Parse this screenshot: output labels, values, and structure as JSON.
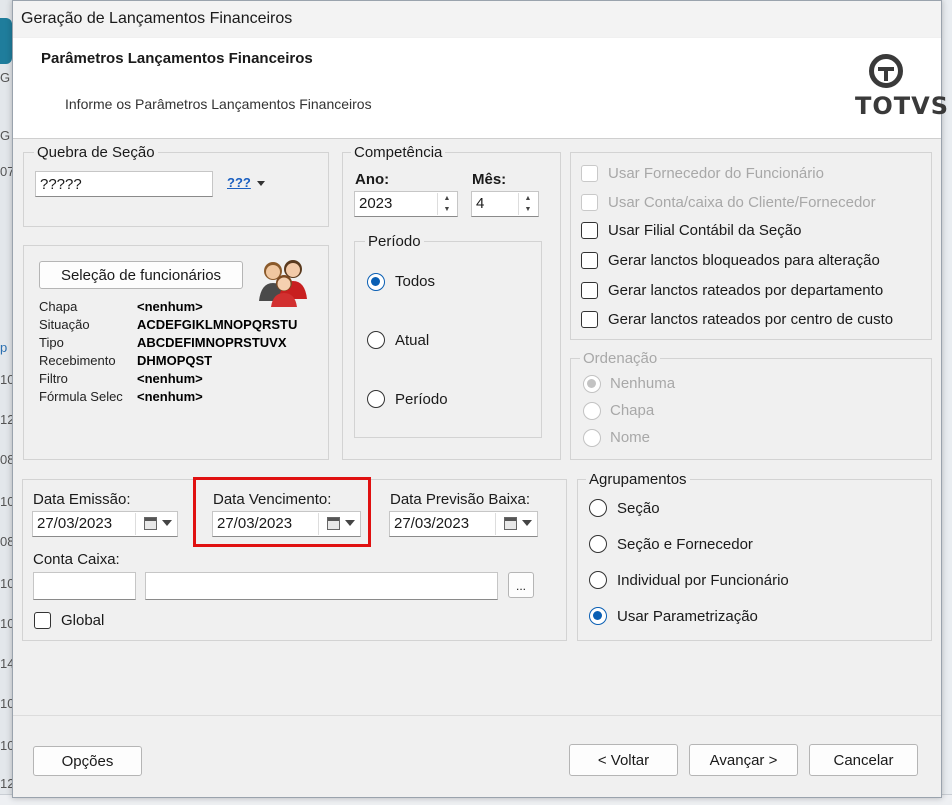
{
  "window": {
    "title": "Geração de Lançamentos Financeiros"
  },
  "background": {
    "left_fragments": [
      "G",
      "G",
      "07",
      "p",
      "10",
      "12",
      "08",
      "10",
      "08",
      "10",
      "10",
      "14",
      "10",
      "10",
      "12"
    ]
  },
  "header": {
    "title": "Parâmetros Lançamentos Financeiros",
    "subtitle": "Informe os Parâmetros Lançamentos Financeiros",
    "logo_text": "TOTVS"
  },
  "quebra": {
    "label": "Quebra de Seção",
    "value": "?????",
    "lookup_label": "???"
  },
  "selecao": {
    "button_label": "Seleção de funcionários",
    "fields": [
      {
        "label": "Chapa",
        "value": "<nenhum>"
      },
      {
        "label": "Situação",
        "value": "ACDEFGIKLMNOPQRSTU"
      },
      {
        "label": "Tipo",
        "value": "ABCDEFIMNOPRSTUVX"
      },
      {
        "label": "Recebimento",
        "value": "DHMOPQST"
      },
      {
        "label": "Filtro",
        "value": "<nenhum>"
      },
      {
        "label": "Fórmula Selec",
        "value": "<nenhum>"
      }
    ]
  },
  "competencia": {
    "label": "Competência",
    "ano_label": "Ano:",
    "ano_value": "2023",
    "mes_label": "Mês:",
    "mes_value": "4",
    "periodo_label": "Período",
    "options": [
      "Todos",
      "Atual",
      "Período"
    ],
    "selected": "Todos"
  },
  "options_checks": [
    {
      "label": "Usar Fornecedor do Funcionário",
      "checked": false,
      "enabled": false
    },
    {
      "label": "Usar Conta/caixa do Cliente/Fornecedor",
      "checked": false,
      "enabled": false
    },
    {
      "label": "Usar Filial Contábil da Seção",
      "checked": false,
      "enabled": true
    },
    {
      "label": "Gerar lanctos bloqueados para alteração",
      "checked": false,
      "enabled": true
    },
    {
      "label": "Gerar lanctos rateados por departamento",
      "checked": false,
      "enabled": true
    },
    {
      "label": "Gerar lanctos rateados por centro de custo",
      "checked": false,
      "enabled": true
    }
  ],
  "ordenacao": {
    "label": "Ordenação",
    "options": [
      "Nenhuma",
      "Chapa",
      "Nome"
    ],
    "selected": "Nenhuma",
    "enabled": false
  },
  "datas": {
    "emissao_label": "Data Emissão:",
    "emissao_value": "27/03/2023",
    "vencimento_label": "Data Vencimento:",
    "vencimento_value": "27/03/2023",
    "previsao_label": "Data Previsão Baixa:",
    "previsao_value": "27/03/2023",
    "conta_label": "Conta Caixa:",
    "conta_code": "",
    "conta_desc": "",
    "lookup_button": "...",
    "global_label": "Global"
  },
  "agrupamentos": {
    "label": "Agrupamentos",
    "options": [
      "Seção",
      "Seção e Fornecedor",
      "Individual por Funcionário",
      "Usar Parametrização"
    ],
    "selected": "Usar Parametrização"
  },
  "footer": {
    "options_btn": "Opções",
    "back_btn": "< Voltar",
    "next_btn": "Avançar >",
    "cancel_btn": "Cancelar"
  },
  "highlight_color": "#e01010",
  "accent_color": "#0a5fb4"
}
